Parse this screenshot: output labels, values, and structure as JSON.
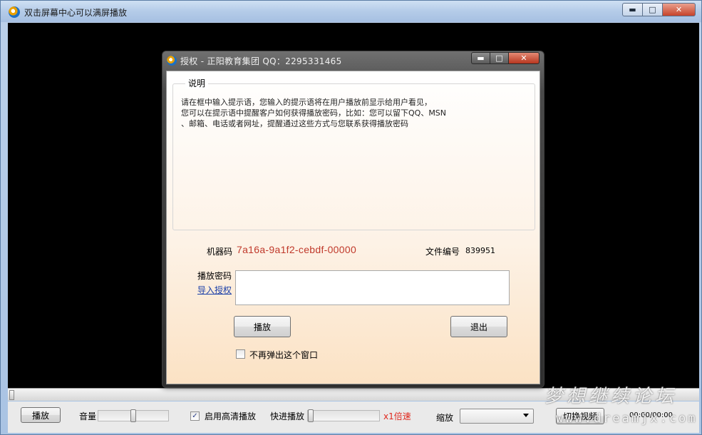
{
  "main_window": {
    "title": "双击屏幕中心可以满屏播放",
    "buttons": {
      "minimize": "▬",
      "maximize": "□",
      "close": "✕"
    }
  },
  "dialog": {
    "title": "授权 - 正阳教育集团 QQ：2295331465",
    "buttons": {
      "minimize": "▬",
      "maximize": "□",
      "close": "✕"
    },
    "group_title": "说明",
    "description_lines": [
      "请在框中输入提示语，您输入的提示语将在用户播放前显示给用户看见，",
      "您可以在提示语中提醒客户如何获得播放密码，比如：您可以留下QQ、MSN",
      "、邮箱、电话或者网址，提醒通过这些方式与您联系获得播放密码"
    ],
    "machine_code_label": "机器码",
    "machine_code_value": "7a16a-9a1f2-cebdf-00000",
    "file_number_label": "文件编号",
    "file_number_value": "839951",
    "password_label": "播放密码",
    "password_value": "",
    "import_link": "导入授权",
    "play_button": "播放",
    "exit_button": "退出",
    "no_popup_label": "不再弹出这个窗口",
    "no_popup_checked": false
  },
  "control_bar": {
    "play_button": "播放",
    "volume_label": "音量",
    "volume_level": 0.5,
    "hd_label": "启用高清播放",
    "hd_checked": true,
    "hd_check_glyph": "✓",
    "fast_forward_label": "快进播放",
    "speed_text": "x1倍速",
    "speed_color": "#e0281e",
    "zoom_label": "缩放",
    "zoom_value": "",
    "switch_video_button": "切换视频",
    "time_text": "00:00/00:00",
    "progress": 0
  },
  "watermark": {
    "line1": "梦想继续论坛",
    "line2": "www.dreamjx.com"
  },
  "icons": {
    "app_icon": "media-player-icon",
    "dropdown": "chevron-down-icon"
  }
}
